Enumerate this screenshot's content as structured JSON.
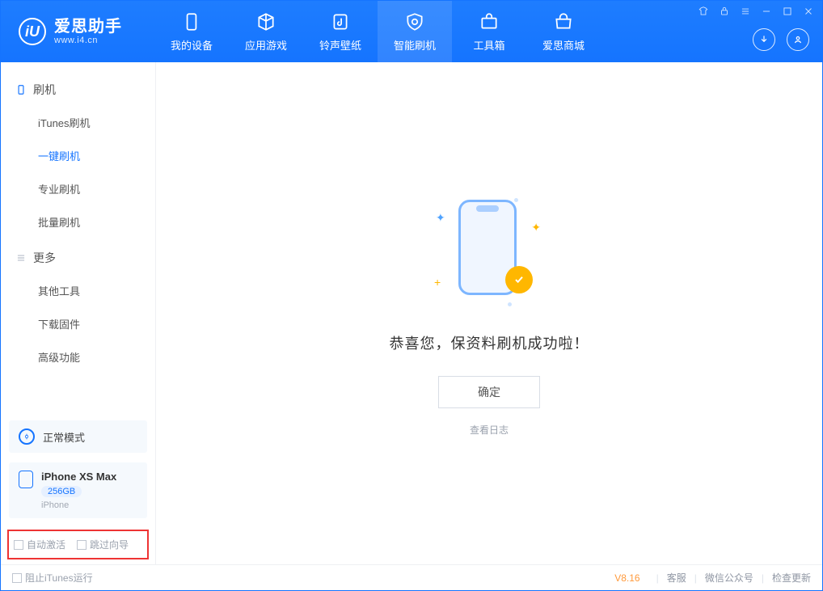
{
  "brand": {
    "title": "爱思助手",
    "subtitle": "www.i4.cn",
    "logo_letter": "iU"
  },
  "nav": {
    "items": [
      {
        "label": "我的设备"
      },
      {
        "label": "应用游戏"
      },
      {
        "label": "铃声壁纸"
      },
      {
        "label": "智能刷机"
      },
      {
        "label": "工具箱"
      },
      {
        "label": "爱思商城"
      }
    ]
  },
  "sidebar": {
    "group1": {
      "title": "刷机",
      "items": [
        "iTunes刷机",
        "一键刷机",
        "专业刷机",
        "批量刷机"
      ],
      "active_index": 1
    },
    "group2": {
      "title": "更多",
      "items": [
        "其他工具",
        "下载固件",
        "高级功能"
      ]
    },
    "mode": {
      "label": "正常模式"
    },
    "device": {
      "name": "iPhone XS Max",
      "capacity": "256GB",
      "type": "iPhone"
    },
    "options": {
      "auto_activate": "自动激活",
      "skip_guide": "跳过向导"
    }
  },
  "main": {
    "success_text": "恭喜您，保资料刷机成功啦！",
    "ok_button": "确定",
    "view_log": "查看日志"
  },
  "footer": {
    "block_itunes": "阻止iTunes运行",
    "version": "V8.16",
    "links": [
      "客服",
      "微信公众号",
      "检查更新"
    ]
  }
}
